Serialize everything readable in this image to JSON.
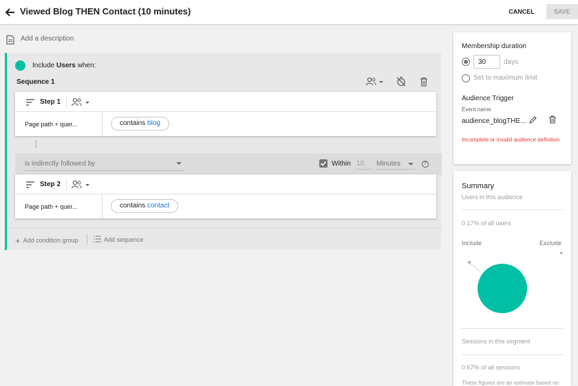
{
  "header": {
    "title": "Viewed Blog THEN Contact (10 minutes)",
    "cancel_label": "CANCEL",
    "save_label": "SAVE"
  },
  "description": {
    "placeholder": "Add a description"
  },
  "group": {
    "include_prefix": "Include",
    "include_scope": "Users",
    "include_suffix": "when:",
    "sequence_title": "Sequence 1",
    "steps": [
      {
        "label": "Step 1",
        "field": "Page path + quer...",
        "operator": "contains",
        "value": "blog"
      },
      {
        "label": "Step 2",
        "field": "Page path + quer...",
        "operator": "contains",
        "value": "contact"
      }
    ],
    "followed_by": "is indirectly followed by",
    "within_checked": true,
    "within_label": "Within",
    "within_value": "10.",
    "within_unit": "Minutes",
    "add_condition_group": "Add condition group",
    "add_sequence": "Add sequence"
  },
  "membership": {
    "title": "Membership duration",
    "duration_value": "30",
    "duration_unit": "days",
    "max_limit_label": "Set to maximum limit",
    "selected_option": "days"
  },
  "trigger": {
    "title": "Audience Trigger",
    "event_name_label": "Event name",
    "event_name_value": "audience_blogTHE...",
    "error": "Incomplete or invalid audience definition"
  },
  "summary": {
    "title": "Summary",
    "users_label": "Users in this audience",
    "users_pct": "0.17% of all users",
    "include_label": "Include",
    "exclude_label": "Exclude",
    "exclude_value": "-",
    "sessions_label": "Sessions in this segment",
    "sessions_pct": "0.67% of all sessions",
    "footnote": "These figures are an estimate based on"
  },
  "colors": {
    "accent": "#00bfa5",
    "link": "#1a73e8",
    "error": "#e53935"
  },
  "icons": [
    "back-arrow-icon",
    "document-icon",
    "people-icon",
    "timer-off-icon",
    "trash-icon",
    "sort-icon",
    "pencil-icon",
    "help-icon",
    "plus-icon",
    "add-sequence-icon"
  ]
}
